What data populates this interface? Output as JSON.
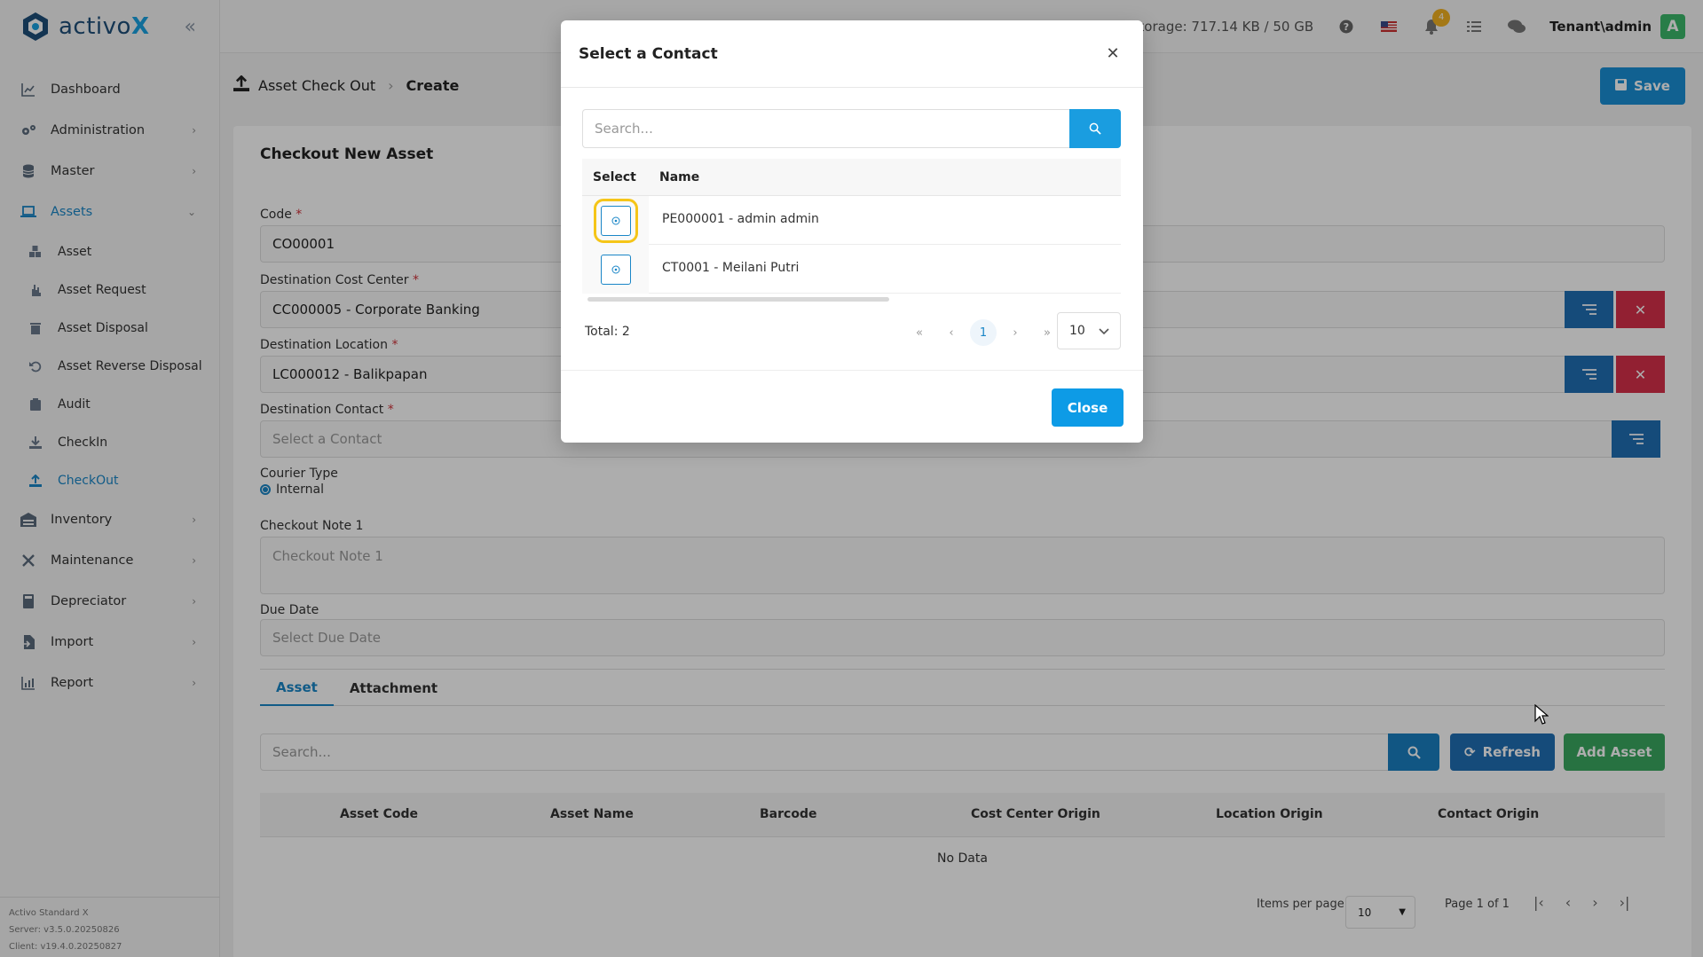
{
  "brand": {
    "name_prefix": "activo",
    "name_suffix": "X"
  },
  "sidebar": {
    "items": [
      {
        "label": "Dashboard",
        "icon": "chart-icon"
      },
      {
        "label": "Administration",
        "icon": "gears-icon"
      },
      {
        "label": "Master",
        "icon": "database-icon"
      },
      {
        "label": "Assets",
        "icon": "laptop-icon",
        "active": true
      },
      {
        "label": "Inventory",
        "icon": "warehouse-icon"
      },
      {
        "label": "Maintenance",
        "icon": "tools-icon"
      },
      {
        "label": "Depreciator",
        "icon": "calculator-icon"
      },
      {
        "label": "Import",
        "icon": "import-icon"
      },
      {
        "label": "Report",
        "icon": "report-icon"
      }
    ],
    "asset_sub": [
      {
        "label": "Asset"
      },
      {
        "label": "Asset Request"
      },
      {
        "label": "Asset Disposal"
      },
      {
        "label": "Asset Reverse Disposal"
      },
      {
        "label": "Audit"
      },
      {
        "label": "CheckIn"
      },
      {
        "label": "CheckOut",
        "active": true
      }
    ],
    "version": {
      "product": "Activo Standard X",
      "server": "Server: v3.5.0.20250826",
      "client": "Client: v19.4.0.20250827"
    }
  },
  "topbar": {
    "storage": "Storage: 717.14 KB / 50 GB",
    "notification_count": "4",
    "user": "Tenant\\admin",
    "avatar_letter": "A"
  },
  "breadcrumb": {
    "parent": "Asset Check Out",
    "current": "Create"
  },
  "save_label": "Save",
  "form": {
    "title": "Checkout New Asset",
    "code_label": "Code",
    "code_value": "CO00001",
    "cost_center_label": "Destination Cost Center",
    "cost_center_value": "CC000005 - Corporate Banking",
    "location_label": "Destination Location",
    "location_value": "LC000012 - Balikpapan",
    "contact_label": "Destination Contact",
    "contact_placeholder": "Select a Contact",
    "courier_label": "Courier Type",
    "courier_value": "Internal",
    "note_label": "Checkout Note 1",
    "note_placeholder": "Checkout Note 1",
    "due_label": "Due Date",
    "due_placeholder": "Select Due Date",
    "required_mark": "*"
  },
  "tabs": [
    {
      "label": "Asset",
      "active": true
    },
    {
      "label": "Attachment"
    }
  ],
  "asset_search_placeholder": "Search...",
  "refresh_label": "Refresh",
  "add_asset_label": "Add Asset",
  "asset_table": {
    "headers": [
      "Asset Code",
      "Asset Name",
      "Barcode",
      "Cost Center Origin",
      "Location Origin",
      "Contact Origin"
    ],
    "empty": "No Data"
  },
  "pager": {
    "items_per_page_label": "Items per page",
    "size": "10",
    "page_text": "Page 1 of 1"
  },
  "modal": {
    "title": "Select a Contact",
    "search_placeholder": "Search...",
    "headers": {
      "select": "Select",
      "name": "Name"
    },
    "rows": [
      {
        "name": "PE000001 - admin admin",
        "highlighted": true
      },
      {
        "name": "CT0001 - Meilani Putri"
      }
    ],
    "total": "Total: 2",
    "current_page": "1",
    "page_size": "10",
    "close_label": "Close"
  },
  "colors": {
    "accent": "#1a86c7",
    "danger": "#d8304b",
    "success": "#3aa860",
    "highlight": "#f5c518"
  }
}
